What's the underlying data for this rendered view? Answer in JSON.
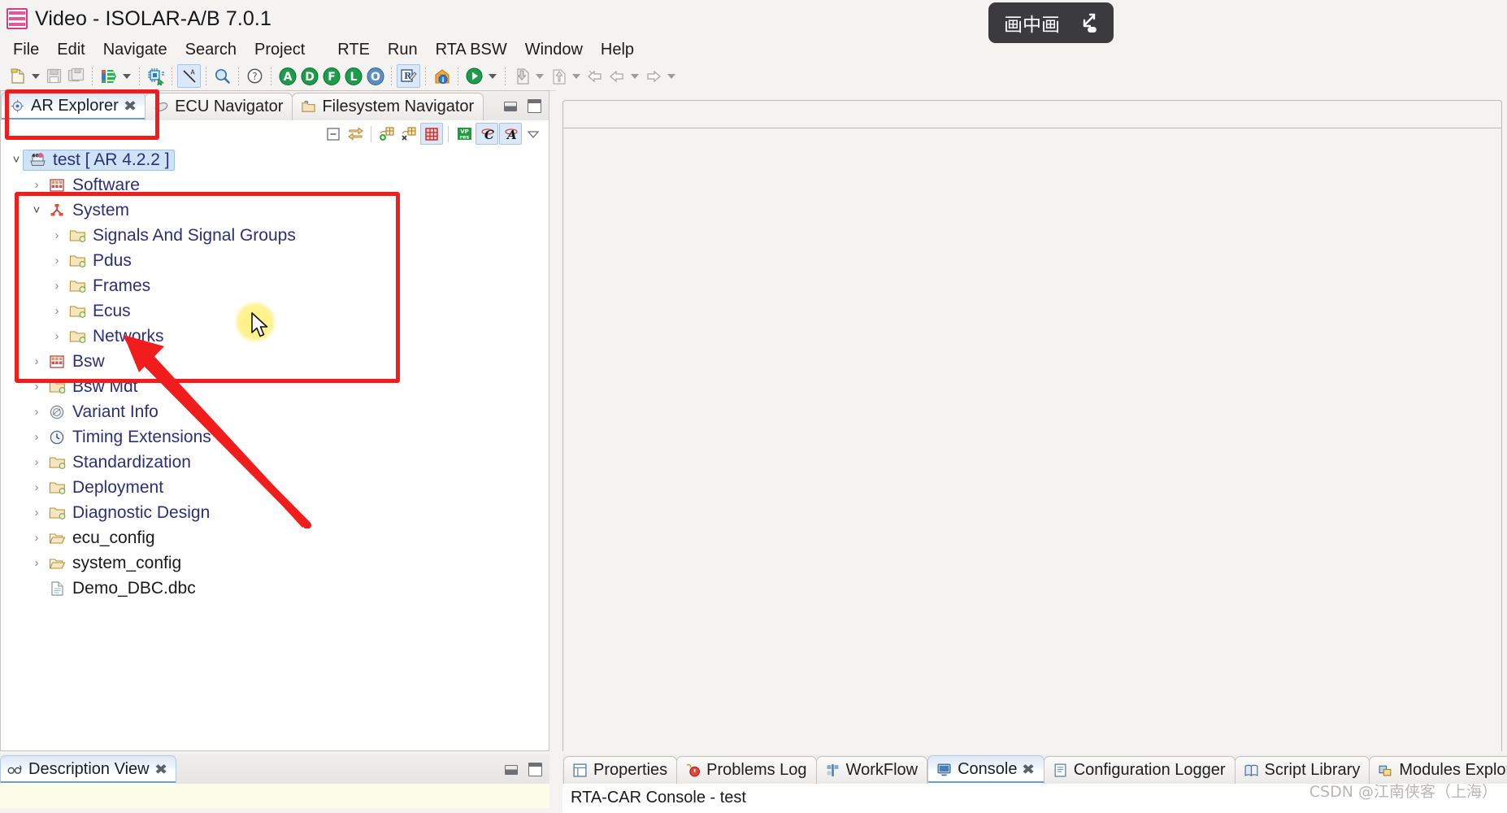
{
  "window": {
    "title": "Video - ISOLAR-A/B 7.0.1",
    "app_icon": "isolar-icon"
  },
  "pip_overlay": {
    "label": "画中画",
    "expand_icon": "pip-expand-icon"
  },
  "menubar": {
    "items": [
      {
        "label": "File"
      },
      {
        "label": "Edit"
      },
      {
        "label": "Navigate"
      },
      {
        "label": "Search"
      },
      {
        "label": "Project"
      },
      {
        "label": "RTE"
      },
      {
        "label": "Run"
      },
      {
        "label": "RTA BSW"
      },
      {
        "label": "Window"
      },
      {
        "label": "Help"
      }
    ]
  },
  "toolbar": {
    "buttons": [
      {
        "name": "new-icon"
      },
      {
        "name": "new-dropdown-caret"
      },
      {
        "name": "save-icon"
      },
      {
        "name": "save-all-icon"
      },
      {
        "name": "import-arxml-icon"
      },
      {
        "name": "import-dropdown-caret"
      },
      {
        "name": "build-chip-icon"
      },
      {
        "name": "validate-icon"
      },
      {
        "name": "search-icon"
      },
      {
        "name": "help-icon"
      },
      {
        "name": "A-icon",
        "letter": "A"
      },
      {
        "name": "D-icon",
        "letter": "D"
      },
      {
        "name": "F-icon",
        "letter": "F"
      },
      {
        "name": "L-icon",
        "letter": "L"
      },
      {
        "name": "O-icon",
        "letter": "O"
      },
      {
        "name": "rte-generate-icon"
      },
      {
        "name": "info-home-icon"
      },
      {
        "name": "run-icon"
      },
      {
        "name": "run-dropdown-caret"
      },
      {
        "name": "export-icon"
      },
      {
        "name": "export-dropdown-caret"
      },
      {
        "name": "upload-icon"
      },
      {
        "name": "upload-dropdown-caret"
      },
      {
        "name": "back-history-icon"
      },
      {
        "name": "back-icon"
      },
      {
        "name": "back-dropdown-caret"
      },
      {
        "name": "forward-icon"
      },
      {
        "name": "forward-dropdown-caret"
      }
    ]
  },
  "explorer_panel": {
    "tabs": [
      {
        "label": "AR Explorer",
        "icon": "ar-explorer-icon",
        "active": true,
        "closable": true
      },
      {
        "label": "ECU Navigator",
        "icon": "ecu-navigator-icon",
        "active": false,
        "closable": false
      },
      {
        "label": "Filesystem Navigator",
        "icon": "filesystem-navigator-icon",
        "active": false,
        "closable": false
      }
    ],
    "view_toolbar": [
      {
        "name": "collapse-all-icon"
      },
      {
        "name": "link-with-editor-icon"
      },
      {
        "name": "add-table-icon"
      },
      {
        "name": "remove-table-icon"
      },
      {
        "name": "grid-filter-icon",
        "selected": true
      },
      {
        "name": "vp-res-icon"
      },
      {
        "name": "c-filter-icon",
        "selected": true
      },
      {
        "name": "a-filter-icon",
        "selected": true
      },
      {
        "name": "view-menu-icon"
      }
    ],
    "controls": [
      {
        "name": "minimize-panel-button"
      },
      {
        "name": "maximize-panel-button"
      }
    ],
    "tree": [
      {
        "label": "test [ AR 4.2.2 ]",
        "icon": "project-icon",
        "indent": 0,
        "expander": "open",
        "selected": true,
        "style": "link"
      },
      {
        "label": "Software",
        "icon": "software-icon",
        "indent": 1,
        "expander": "closed",
        "selected": false,
        "style": "link"
      },
      {
        "label": "System",
        "icon": "system-icon",
        "indent": 1,
        "expander": "open",
        "selected": false,
        "style": "link"
      },
      {
        "label": "Signals And Signal Groups",
        "icon": "folder-icon",
        "indent": 2,
        "expander": "closed",
        "selected": false,
        "style": "link"
      },
      {
        "label": "Pdus",
        "icon": "folder-icon",
        "indent": 2,
        "expander": "closed",
        "selected": false,
        "style": "link"
      },
      {
        "label": "Frames",
        "icon": "folder-icon",
        "indent": 2,
        "expander": "closed",
        "selected": false,
        "style": "link"
      },
      {
        "label": "Ecus",
        "icon": "folder-icon",
        "indent": 2,
        "expander": "closed",
        "selected": false,
        "style": "link"
      },
      {
        "label": "Networks",
        "icon": "folder-icon",
        "indent": 2,
        "expander": "closed",
        "selected": false,
        "style": "link"
      },
      {
        "label": "Bsw",
        "icon": "software-icon",
        "indent": 1,
        "expander": "closed",
        "selected": false,
        "style": "link"
      },
      {
        "label": "Bsw Mdt",
        "icon": "folder-icon",
        "indent": 1,
        "expander": "closed",
        "selected": false,
        "style": "link"
      },
      {
        "label": "Variant Info",
        "icon": "variant-icon",
        "indent": 1,
        "expander": "closed",
        "selected": false,
        "style": "link"
      },
      {
        "label": "Timing Extensions",
        "icon": "clock-icon",
        "indent": 1,
        "expander": "closed",
        "selected": false,
        "style": "link"
      },
      {
        "label": "Standardization",
        "icon": "folder-icon",
        "indent": 1,
        "expander": "closed",
        "selected": false,
        "style": "link"
      },
      {
        "label": "Deployment",
        "icon": "folder-icon",
        "indent": 1,
        "expander": "closed",
        "selected": false,
        "style": "link"
      },
      {
        "label": "Diagnostic Design",
        "icon": "folder-icon",
        "indent": 1,
        "expander": "closed",
        "selected": false,
        "style": "link"
      },
      {
        "label": "ecu_config",
        "icon": "open-folder-icon",
        "indent": 1,
        "expander": "closed",
        "selected": false,
        "style": "plain"
      },
      {
        "label": "system_config",
        "icon": "open-folder-icon",
        "indent": 1,
        "expander": "closed",
        "selected": false,
        "style": "plain"
      },
      {
        "label": "Demo_DBC.dbc",
        "icon": "file-icon",
        "indent": 1,
        "expander": "none",
        "selected": false,
        "style": "plain"
      }
    ]
  },
  "description_panel": {
    "tabs": [
      {
        "label": "Description View",
        "icon": "glasses-icon",
        "active": true,
        "closable": true
      }
    ],
    "controls": [
      {
        "name": "minimize-panel-button"
      },
      {
        "name": "maximize-panel-button"
      }
    ]
  },
  "bottom_panel": {
    "tabs": [
      {
        "label": "Properties",
        "icon": "properties-icon",
        "active": false,
        "closable": false
      },
      {
        "label": "Problems Log",
        "icon": "problems-log-icon",
        "active": false,
        "closable": false
      },
      {
        "label": "WorkFlow",
        "icon": "workflow-icon",
        "active": false,
        "closable": false
      },
      {
        "label": "Console",
        "icon": "console-icon",
        "active": true,
        "closable": true
      },
      {
        "label": "Configuration Logger",
        "icon": "configuration-logger-icon",
        "active": false,
        "closable": false
      },
      {
        "label": "Script Library",
        "icon": "script-library-icon",
        "active": false,
        "closable": false
      },
      {
        "label": "Modules Explorer",
        "icon": "modules-explorer-icon",
        "active": false,
        "closable": false
      }
    ],
    "console_title": "RTA-CAR Console - test"
  },
  "watermark": "CSDN @江南侠客（上海）",
  "colors": {
    "annotation_red": "#f11d1d",
    "tree_link": "#2b2f7a",
    "selection_blue": "#cfe3f7",
    "panel_bg": "#f4f3f2"
  }
}
